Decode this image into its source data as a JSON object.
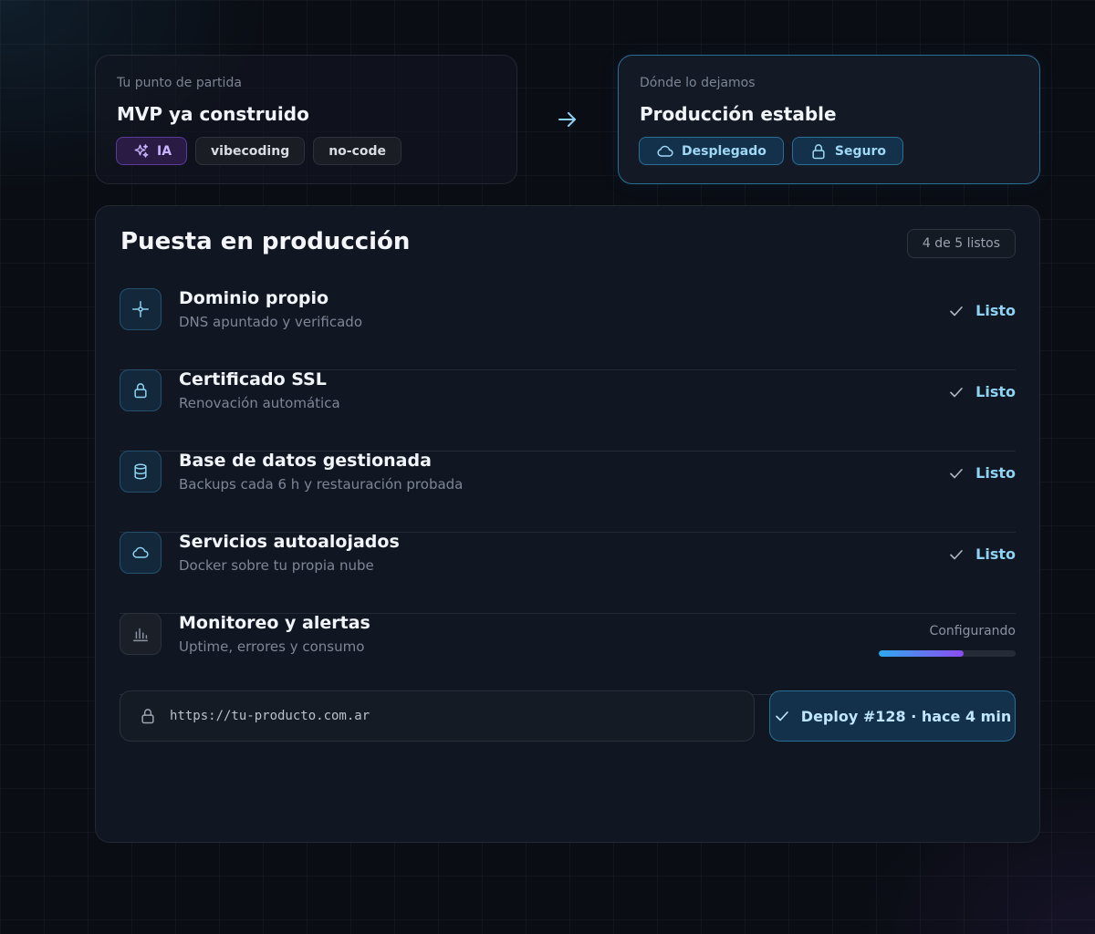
{
  "start": {
    "label": "Tu punto de partida",
    "title": "MVP ya construido",
    "tags": [
      "IA",
      "vibecoding",
      "no-code"
    ]
  },
  "end": {
    "label": "Dónde lo dejamos",
    "title": "Producción estable",
    "tags": [
      "Desplegado",
      "Seguro"
    ]
  },
  "checklist": {
    "title": "Puesta en producción",
    "counter": "4 de 5 listos",
    "items": [
      {
        "title": "Dominio propio",
        "subtitle": "DNS apuntado y verificado",
        "status": "Listo",
        "icon": "crosshair-icon"
      },
      {
        "title": "Certificado SSL",
        "subtitle": "Renovación automática",
        "status": "Listo",
        "icon": "lock-icon"
      },
      {
        "title": "Base de datos gestionada",
        "subtitle": "Backups cada 6 h y restauración probada",
        "status": "Listo",
        "icon": "database-icon"
      },
      {
        "title": "Servicios autoalojados",
        "subtitle": "Docker sobre tu propia nube",
        "status": "Listo",
        "icon": "cloud-icon"
      },
      {
        "title": "Monitoreo y alertas",
        "subtitle": "Uptime, errores y consumo",
        "status": "Configurando",
        "progress": 0.62,
        "icon": "bar-chart-icon"
      }
    ]
  },
  "footer": {
    "url": "https://tu-producto.com.ar",
    "deploy_label": "Deploy #128 · hace 4 min"
  },
  "colors": {
    "accent": "#8fd3f4",
    "ai_tag": "#c9b4ff",
    "progress_start": "#2fa8ee",
    "progress_end": "#8b4cf2"
  }
}
